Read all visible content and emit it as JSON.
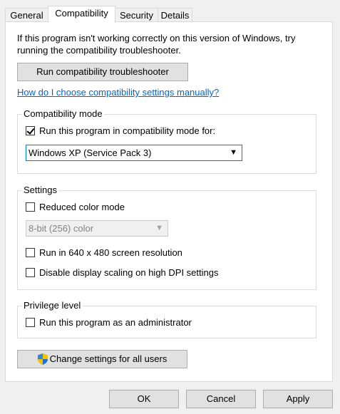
{
  "tabs": [
    "General",
    "Compatibility",
    "Security",
    "Details"
  ],
  "intro": "If this program isn't working correctly on this version of Windows, try running the compatibility troubleshooter.",
  "troubleshooter_button": "Run compatibility troubleshooter",
  "help_link": "How do I choose compatibility settings manually?",
  "compat_mode": {
    "title": "Compatibility mode",
    "checkbox_label": "Run this program in compatibility mode for:",
    "checked": true,
    "selected_os": "Windows XP (Service Pack 3)"
  },
  "settings": {
    "title": "Settings",
    "reduced_color": "Reduced color mode",
    "color_select": "8-bit (256) color",
    "res_640": "Run in 640 x 480 screen resolution",
    "dpi": "Disable display scaling on high DPI settings"
  },
  "privilege": {
    "title": "Privilege level",
    "admin": "Run this program as an administrator"
  },
  "change_all_button": "Change settings for all users",
  "footer": {
    "ok": "OK",
    "cancel": "Cancel",
    "apply": "Apply"
  }
}
